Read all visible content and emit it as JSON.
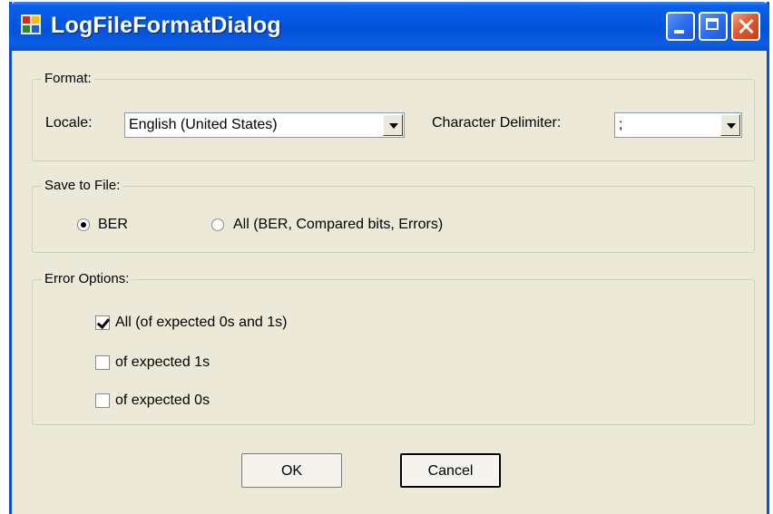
{
  "window": {
    "title": "LogFileFormatDialog"
  },
  "format": {
    "group_label": "Format:",
    "locale_label": "Locale:",
    "locale_value": "English (United States)",
    "delimiter_label": "Character Delimiter:",
    "delimiter_value": ";"
  },
  "save_to_file": {
    "group_label": "Save to File:",
    "options": [
      {
        "label": "BER",
        "selected": true
      },
      {
        "label": "All (BER, Compared bits, Errors)",
        "selected": false
      }
    ]
  },
  "error_options": {
    "group_label": "Error Options:",
    "items": [
      {
        "label": "All (of expected 0s and 1s)",
        "checked": true
      },
      {
        "label": "of expected 1s",
        "checked": false
      },
      {
        "label": "of expected 0s",
        "checked": false
      }
    ]
  },
  "buttons": {
    "ok": "OK",
    "cancel": "Cancel"
  },
  "colors": {
    "titlebar": "#0a4ed6",
    "dialog_bg": "#ece9d8"
  }
}
